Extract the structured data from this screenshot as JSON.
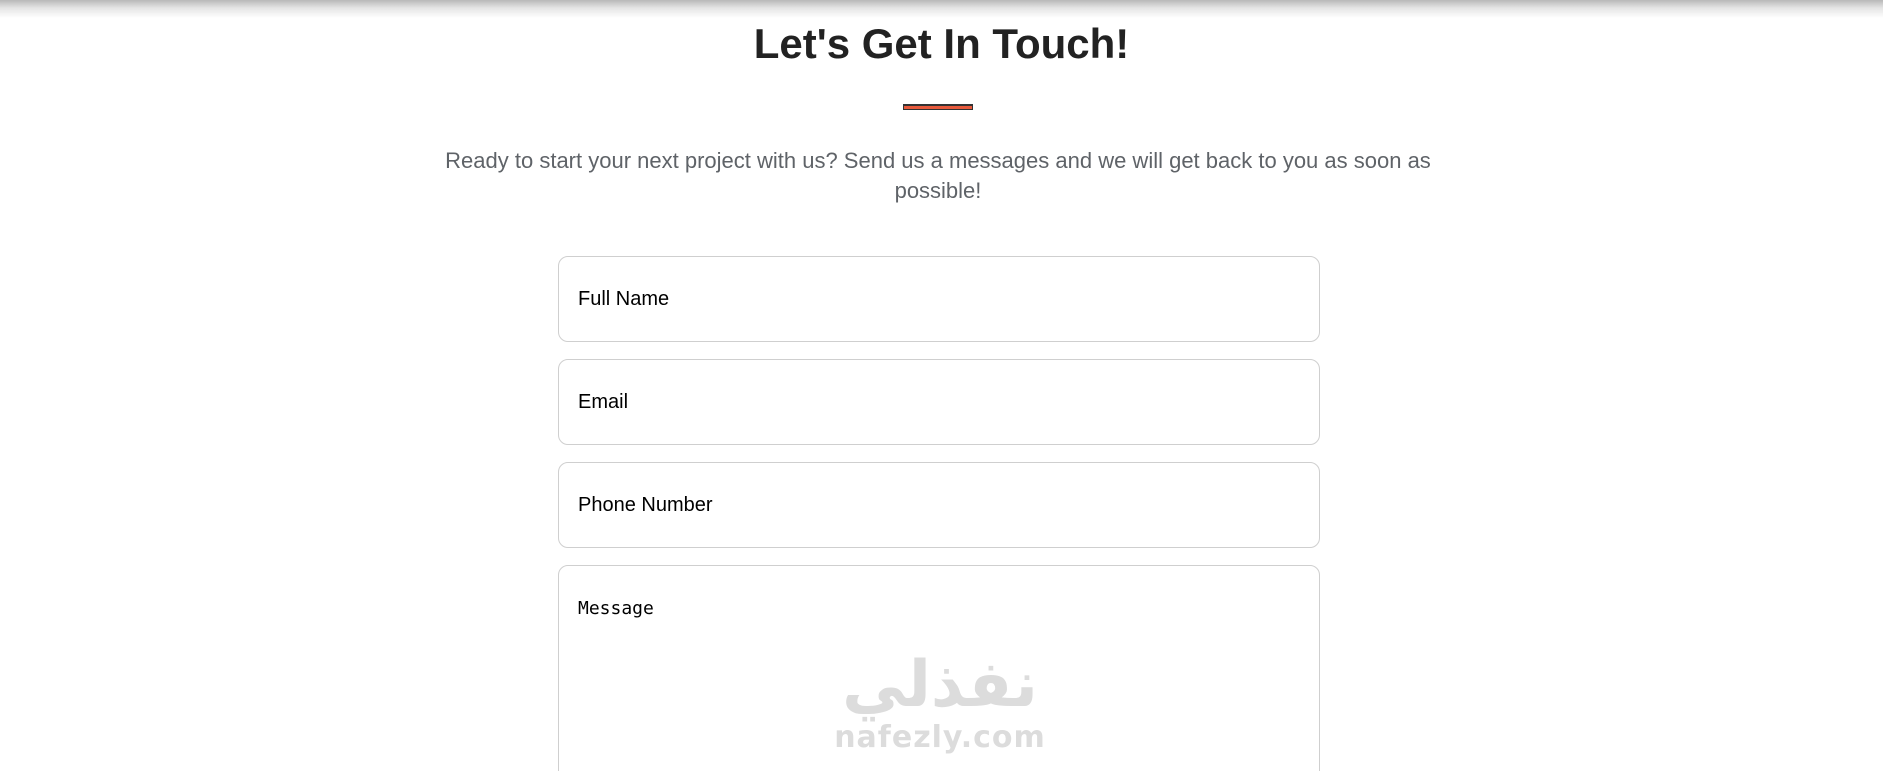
{
  "header": {
    "title": "Let's Get In Touch!",
    "subtitle": "Ready to start your next project with us? Send us a messages and we will get back to you as soon as possible!",
    "accent_color": "#e85a3c"
  },
  "form": {
    "full_name": {
      "placeholder": "Full Name"
    },
    "email": {
      "placeholder": "Email"
    },
    "phone": {
      "placeholder": "Phone Number"
    },
    "message": {
      "placeholder": "Message"
    }
  },
  "watermark": {
    "arabic": "نفذلي",
    "latin": "nafezly.com"
  }
}
